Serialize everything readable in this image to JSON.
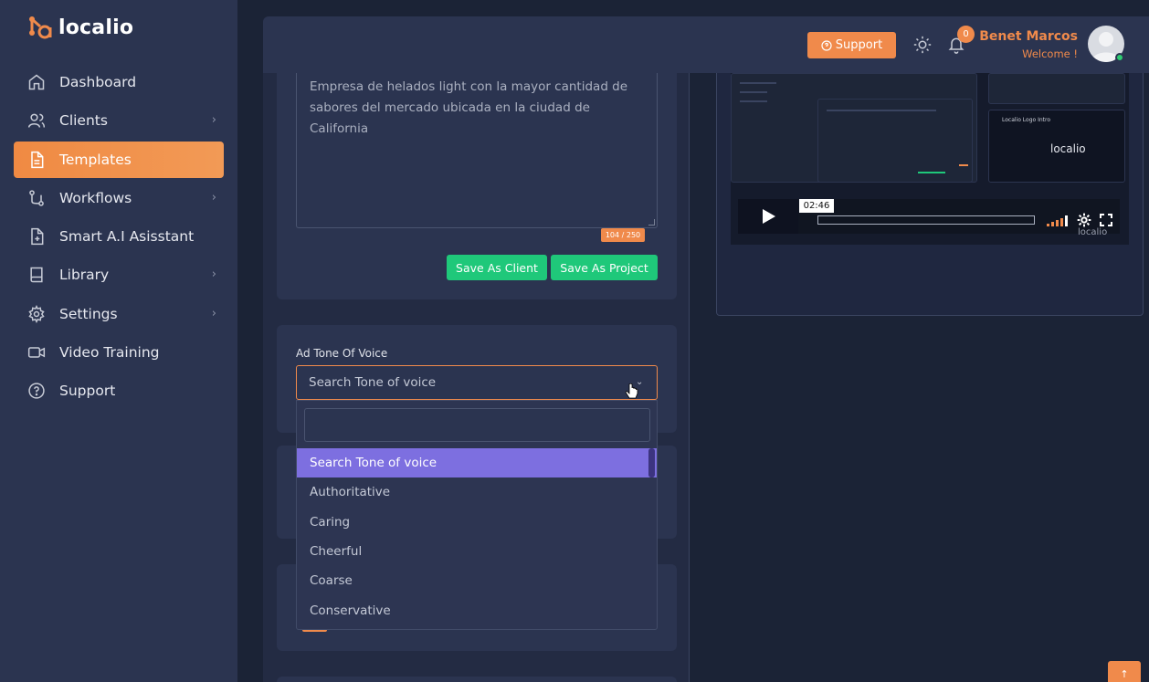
{
  "app": {
    "name": "localio"
  },
  "sidebar": {
    "items": [
      {
        "label": "Dashboard",
        "icon": "home-icon",
        "has_children": false,
        "active": false
      },
      {
        "label": "Clients",
        "icon": "users-icon",
        "has_children": true,
        "active": false
      },
      {
        "label": "Templates",
        "icon": "document-icon",
        "has_children": false,
        "active": true
      },
      {
        "label": "Workflows",
        "icon": "git-branch-icon",
        "has_children": true,
        "active": false
      },
      {
        "label": "Smart A.I Asisstant",
        "icon": "file-plus-icon",
        "has_children": false,
        "active": false
      },
      {
        "label": "Library",
        "icon": "book-icon",
        "has_children": true,
        "active": false
      },
      {
        "label": "Settings",
        "icon": "gear-icon",
        "has_children": true,
        "active": false
      },
      {
        "label": "Video Training",
        "icon": "video-icon",
        "has_children": false,
        "active": false
      },
      {
        "label": "Support",
        "icon": "help-circle-icon",
        "has_children": false,
        "active": false
      }
    ]
  },
  "topbar": {
    "support_label": "Support",
    "notification_count": "0",
    "user_name": "Benet Marcos",
    "welcome": "Welcome !"
  },
  "description": {
    "text": "Empresa de helados light con la mayor cantidad de sabores del mercado ubicada en la ciudad de California",
    "counter": "104 / 250",
    "save_client_label": "Save As Client",
    "save_project_label": "Save As Project"
  },
  "tone": {
    "label": "Ad Tone Of Voice",
    "selected": "Search Tone of voice",
    "search_value": "",
    "options": [
      {
        "label": "Search Tone of voice",
        "selected": true
      },
      {
        "label": "Authoritative",
        "selected": false
      },
      {
        "label": "Caring",
        "selected": false
      },
      {
        "label": "Cheerful",
        "selected": false
      },
      {
        "label": "Coarse",
        "selected": false
      },
      {
        "label": "Conservative",
        "selected": false
      }
    ]
  },
  "video": {
    "time": "02:46",
    "watermark": "localio",
    "inner_title": "Localio Logo Intro"
  },
  "colors": {
    "accent": "#f08a4b",
    "sidebar_bg": "#2b3450",
    "page_bg": "#1b2336",
    "success": "#1fc87a",
    "selected_option": "#7d6fe0"
  }
}
